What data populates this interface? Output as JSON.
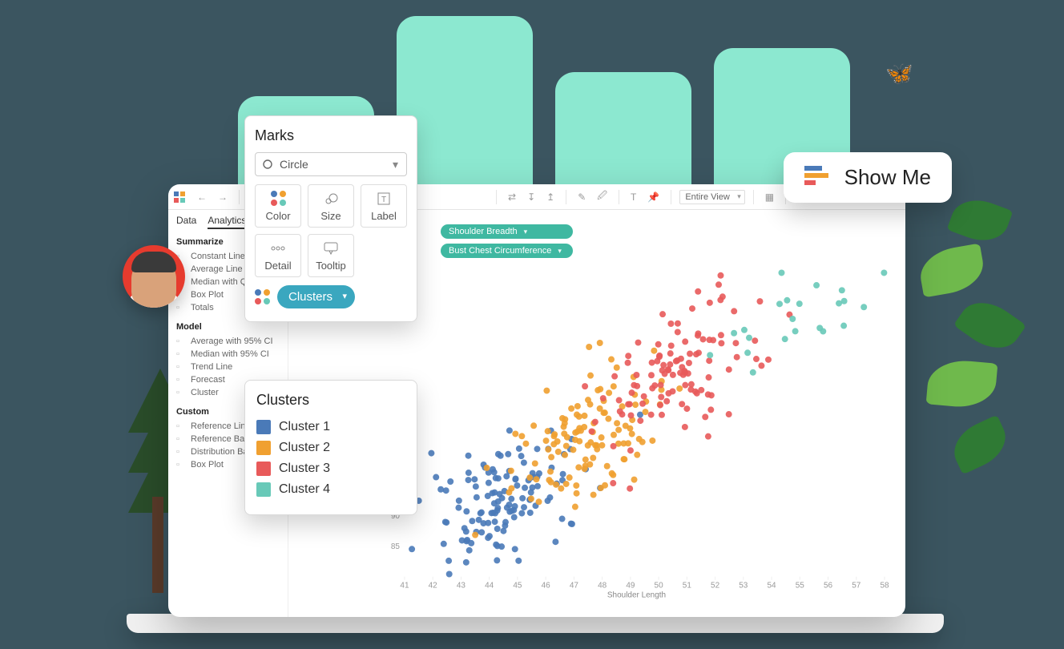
{
  "toolbar": {
    "view_mode": "Entire View"
  },
  "pane": {
    "tabs": [
      "Data",
      "Analytics"
    ],
    "summarize_title": "Summarize",
    "summarize_items": [
      "Constant Line",
      "Average Line",
      "Median with Quartiles",
      "Box Plot",
      "Totals"
    ],
    "model_title": "Model",
    "model_items": [
      "Average with 95% CI",
      "Median with 95% CI",
      "Trend Line",
      "Forecast",
      "Cluster"
    ],
    "custom_title": "Custom",
    "custom_items": [
      "Reference Line",
      "Reference Band",
      "Distribution Band",
      "Box Plot"
    ]
  },
  "shelves": {
    "columns": "Shoulder Breadth",
    "rows": "Bust Chest Circumference"
  },
  "marks": {
    "title": "Marks",
    "shape": "Circle",
    "cells": [
      "Color",
      "Size",
      "Label",
      "Detail",
      "Tooltip"
    ],
    "active": "Clusters"
  },
  "legend": {
    "title": "Clusters",
    "items": [
      {
        "label": "Cluster 1",
        "color": "#4a7ab8"
      },
      {
        "label": "Cluster 2",
        "color": "#f0a030"
      },
      {
        "label": "Cluster 3",
        "color": "#e85a5a"
      },
      {
        "label": "Cluster 4",
        "color": "#68c9b8"
      }
    ]
  },
  "showme": {
    "label": "Show Me"
  },
  "chart_data": {
    "type": "scatter",
    "xlabel": "Shoulder Length",
    "ylabel": "",
    "xlim": [
      41,
      58
    ],
    "ylim": [
      80,
      130
    ],
    "x_ticks": [
      41,
      42,
      43,
      44,
      45,
      46,
      47,
      48,
      49,
      50,
      51,
      52,
      53,
      54,
      55,
      56,
      57,
      58
    ],
    "y_ticks": [
      85,
      90
    ],
    "series": [
      {
        "name": "Cluster 1",
        "color": "#4a7ab8"
      },
      {
        "name": "Cluster 2",
        "color": "#f0a030"
      },
      {
        "name": "Cluster 3",
        "color": "#e85a5a"
      },
      {
        "name": "Cluster 4",
        "color": "#68c9b8"
      }
    ],
    "note": "Dense scatter ~400 points, positively correlated; clusters form diagonal bands from lower-left (Cluster 1) through mid (Cluster 2) to upper (Cluster 3); Cluster 4 sparse at top-right."
  }
}
